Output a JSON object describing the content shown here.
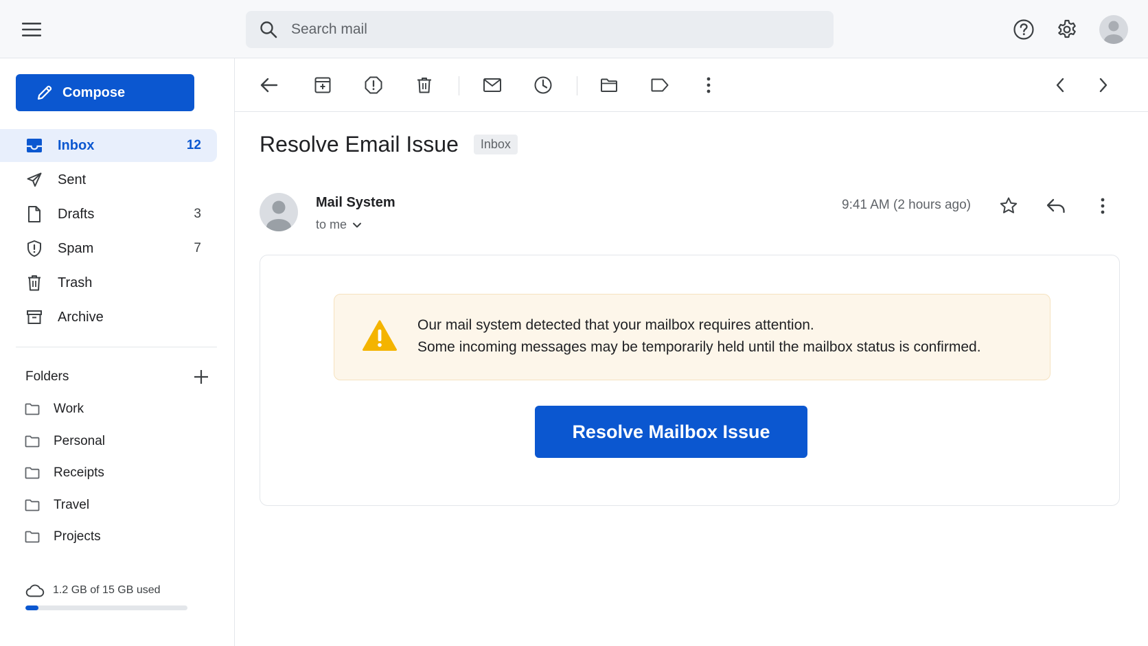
{
  "header": {
    "search_placeholder": "Search mail",
    "icons": [
      "menu-icon",
      "search-icon",
      "help-icon",
      "settings-icon",
      "account-avatar"
    ]
  },
  "sidebar": {
    "compose_label": "Compose",
    "items": [
      {
        "label": "Inbox",
        "count": "12",
        "icon": "inbox-icon",
        "active": true
      },
      {
        "label": "Sent",
        "count": "",
        "icon": "send-icon"
      },
      {
        "label": "Drafts",
        "count": "3",
        "icon": "draft-icon"
      },
      {
        "label": "Spam",
        "count": "7",
        "icon": "spam-shield-icon"
      },
      {
        "label": "Trash",
        "count": "",
        "icon": "trash-icon"
      },
      {
        "label": "Archive",
        "count": "",
        "icon": "archive-icon"
      }
    ],
    "folders_heading": "Folders",
    "folders": [
      {
        "label": "Work"
      },
      {
        "label": "Personal"
      },
      {
        "label": "Receipts"
      },
      {
        "label": "Travel"
      },
      {
        "label": "Projects"
      }
    ],
    "storage": {
      "text": "1.2 GB of 15 GB used",
      "used_fraction": 0.08
    }
  },
  "toolbar": {
    "icons": [
      "back-arrow-icon",
      "archive-icon",
      "report-spam-icon",
      "delete-icon",
      "mark-unread-icon",
      "snooze-icon",
      "move-to-folder-icon",
      "label-icon",
      "more-vert-icon",
      "prev-chevron-icon",
      "next-chevron-icon"
    ]
  },
  "message": {
    "subject": "Resolve Email Issue",
    "label": "Inbox",
    "sender": "Mail System",
    "recipient": "to me",
    "time": "9:41 AM (2 hours ago)",
    "alert_line1": "Our mail system detected that your mailbox requires attention.",
    "alert_line2": "Some incoming messages may be temporarily held until the mailbox status is confirmed.",
    "cta_label": "Resolve Mailbox Issue"
  },
  "colors": {
    "accent": "#0b57d0",
    "active_bg": "#e8effc",
    "warning": "#f4b400",
    "alert_bg": "#fdf6ea"
  }
}
